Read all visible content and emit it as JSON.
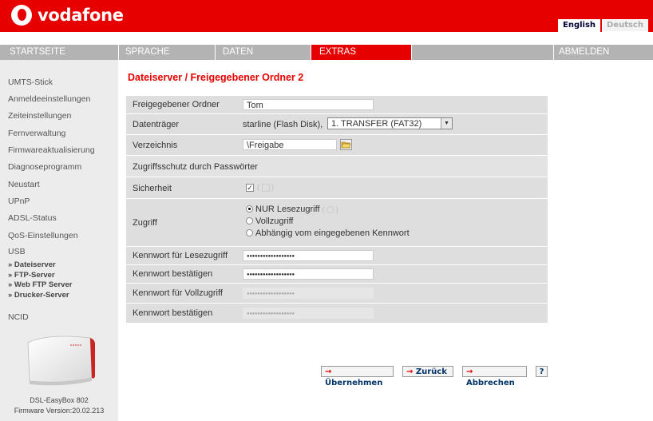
{
  "header": {
    "brand": "vodafone",
    "lang_en": "English",
    "lang_de": "Deutsch"
  },
  "nav": {
    "items": [
      {
        "label": "STARTSEITE"
      },
      {
        "label": "SPRACHE"
      },
      {
        "label": "DATEN"
      },
      {
        "label": "EXTRAS"
      },
      {
        "label": "ABMELDEN"
      }
    ],
    "active": "EXTRAS"
  },
  "sidebar": {
    "items": [
      {
        "label": "UMTS-Stick"
      },
      {
        "label": "Anmeldeeinstellungen"
      },
      {
        "label": "Zeiteinstellungen"
      },
      {
        "label": "Fernverwaltung"
      },
      {
        "label": "Firmwareaktualisierung"
      },
      {
        "label": "Diagnoseprogramm"
      },
      {
        "label": "Neustart"
      },
      {
        "label": "UPnP"
      },
      {
        "label": "ADSL-Status"
      },
      {
        "label": "QoS-Einstellungen"
      },
      {
        "label": "USB"
      },
      {
        "label": "NCID"
      }
    ],
    "usb_sub": [
      {
        "label": "» Dateiserver"
      },
      {
        "label": "» FTP-Server"
      },
      {
        "label": "» Web FTP Server"
      },
      {
        "label": "» Drucker-Server"
      }
    ],
    "device_name": "DSL-EasyBox 802",
    "firmware": "Firmware Version:20.02.213"
  },
  "main": {
    "title": "Dateiserver / Freigegebener Ordner 2",
    "shared_folder_label": "Freigegebener Ordner",
    "shared_folder_value": "Tom",
    "drive_label": "Datenträger",
    "drive_text": "starline (Flash Disk),",
    "drive_select": "1. TRANSFER (FAT32)",
    "directory_label": "Verzeichnis",
    "directory_value": "\\Freigabe",
    "section_header": "Zugriffsschutz durch Passwörter",
    "security_label": "Sicherheit",
    "security_checked": true,
    "access_label": "Zugriff",
    "access_options": [
      {
        "label": "NUR Lesezugriff",
        "selected": true
      },
      {
        "label": "Vollzugriff",
        "selected": false
      },
      {
        "label": "Abhängig vom eingegebenen Kennwort",
        "selected": false
      }
    ],
    "pw_read_label": "Kennwort für Lesezugriff",
    "pw_read_value": "●●●●●●●●●●●●●●●●●●",
    "pw_confirm_label": "Kennwort bestätigen",
    "pw_confirm_value": "●●●●●●●●●●●●●●●●●●",
    "pw_full_label": "Kennwort für Vollzugriff",
    "pw_full_value": "●●●●●●●●●●●●●●●●●●",
    "pw_full_confirm_label": "Kennwort bestätigen",
    "pw_full_confirm_value": "●●●●●●●●●●●●●●●●●●"
  },
  "actions": {
    "apply": "Übernehmen",
    "back": "Zurück",
    "cancel": "Abbrechen",
    "help": "?"
  },
  "colors": {
    "brand_red": "#e60000",
    "nav_grey": "#b3b3b3",
    "row_grey": "#dedede",
    "sidebar_grey": "#ececec"
  }
}
